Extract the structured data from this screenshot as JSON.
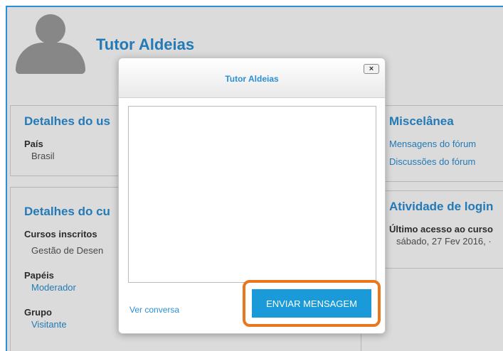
{
  "profile": {
    "name": "Tutor Aldeias"
  },
  "user_details": {
    "title": "Detalhes do us",
    "country_label": "País",
    "country_value": "Brasil"
  },
  "course_details": {
    "title": "Detalhes do cu",
    "enrolled_label": "Cursos inscritos",
    "enrolled_value": "Gestão de Desen",
    "roles_label": "Papéis",
    "roles_value": "Moderador",
    "group_label": "Grupo",
    "group_value": "Visitante"
  },
  "misc": {
    "title": "Miscelânea",
    "forum_posts": "Mensagens do fórum",
    "forum_discussions": "Discussões do fórum"
  },
  "login_activity": {
    "title": "Atividade de login",
    "last_access_label": "Último acesso ao curso",
    "last_access_value": "sábado, 27 Fev 2016, ·"
  },
  "modal": {
    "title": "Tutor Aldeias",
    "close_label": "×",
    "message_value": "",
    "view_conversation": "Ver conversa",
    "send_label": "ENVIAR MENSAGEM",
    "highlight_color": "#e8771e",
    "button_color": "#1a9ad8"
  }
}
